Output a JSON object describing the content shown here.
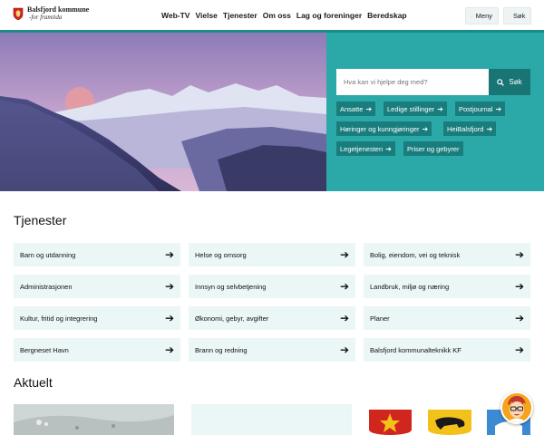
{
  "header": {
    "logo_name": "Balsfjord kommune",
    "logo_sub": "-for framtida",
    "nav": [
      "Web-TV",
      "Vielse",
      "Tjenester",
      "Om oss",
      "Lag og foreninger",
      "Beredskap"
    ],
    "menu_label": "Meny",
    "search_label": "Søk"
  },
  "hero": {
    "search_placeholder": "Hva kan vi hjelpe deg med?",
    "search_button": "Søk",
    "quick_links": [
      "Ansatte",
      "Ledige stillinger",
      "Postjournal",
      "Høringer og kunngjøringer",
      "HeiBalsfjord",
      "Legetjenesten",
      "Priser og gebyrer"
    ]
  },
  "tjenester": {
    "title": "Tjenester",
    "items": [
      "Barn og utdanning",
      "Helse og omsorg",
      "Bolig, eiendom, vei og teknisk",
      "Administrasjonen",
      "Innsyn og selvbetjening",
      "Landbruk, miljø og næring",
      "Kultur, fritid og integrering",
      "Økonomi, gebyr, avgifter",
      "Planer",
      "Bergneset Havn",
      "Brann og redning",
      "Balsfjord kommunalteknikk KF"
    ]
  },
  "aktuelt": {
    "title": "Aktuelt"
  },
  "colors": {
    "teal": "#2ba8a8",
    "teal_dark": "#197474",
    "tile_bg": "#eaf7f6"
  },
  "icons": {
    "arrow": "arrow-right-icon",
    "menu": "hamburger-icon",
    "search": "search-icon"
  }
}
